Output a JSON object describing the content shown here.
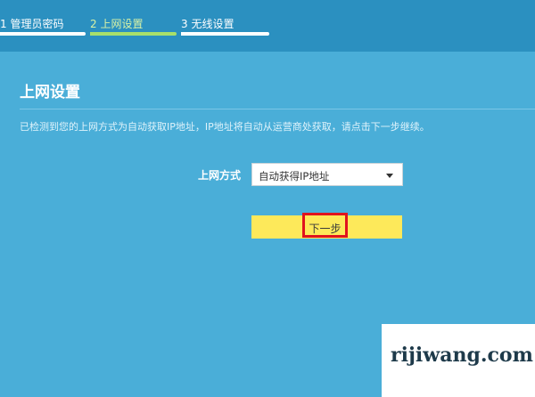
{
  "steps": [
    {
      "label": "1 管理员密码",
      "active": false
    },
    {
      "label": "2 上网设置",
      "active": true
    },
    {
      "label": "3 无线设置",
      "active": false
    }
  ],
  "page": {
    "title": "上网设置",
    "description": "已检测到您的上网方式为自动获取IP地址，IP地址将自动从运营商处获取，请点击下一步继续。"
  },
  "form": {
    "connection_type_label": "上网方式",
    "connection_type_value": "自动获得IP地址"
  },
  "next_button_label": "下一步",
  "watermark": "rijiwang.com",
  "colors": {
    "background": "#4aaed8",
    "topbar": "#2b90c0",
    "active_step": "#a8e06a",
    "button": "#fde95a",
    "highlight": "#e0141e"
  }
}
